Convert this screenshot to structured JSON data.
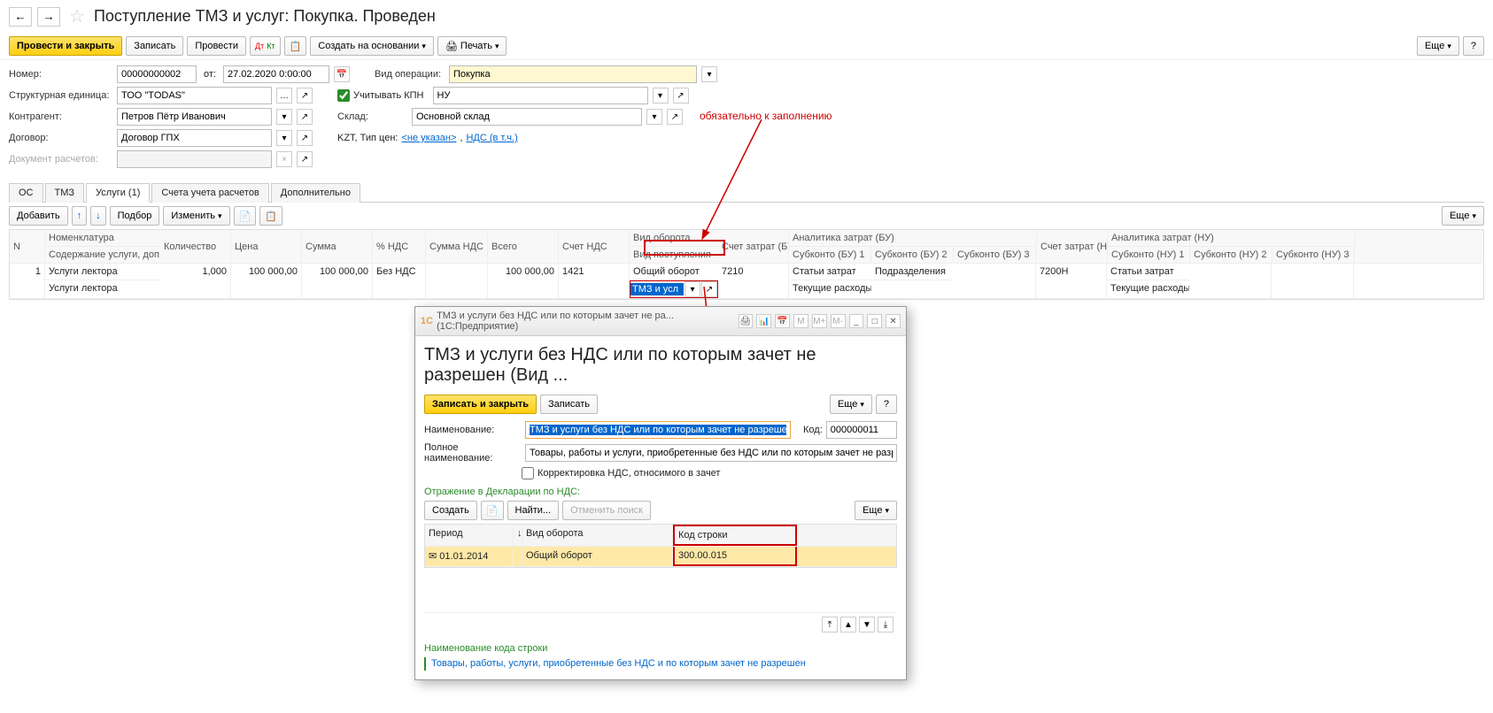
{
  "header": {
    "title": "Поступление ТМЗ и услуг: Покупка. Проведен"
  },
  "toolbar": {
    "post_close": "Провести и закрыть",
    "write": "Записать",
    "post": "Провести",
    "create_based": "Создать на основании",
    "print": "Печать",
    "more": "Еще",
    "help": "?"
  },
  "form": {
    "number_label": "Номер:",
    "number_value": "00000000002",
    "from_label": "от:",
    "date_value": "27.02.2020 0:00:00",
    "operation_label": "Вид операции:",
    "operation_value": "Покупка",
    "unit_label": "Структурная единица:",
    "unit_value": "ТОО \"TODAS\"",
    "kpn_label": "Учитывать КПН",
    "kpn_value": "НУ",
    "counterparty_label": "Контрагент:",
    "counterparty_value": "Петров Пётр Иванович",
    "warehouse_label": "Склад:",
    "warehouse_value": "Основной склад",
    "contract_label": "Договор:",
    "contract_value": "Договор ГПХ",
    "settlement_doc_label": "Документ расчетов:",
    "price_info_prefix": "KZT, Тип цен: ",
    "price_info_link1": "<не указан>",
    "price_info_sep": ", ",
    "price_info_link2": "НДС (в т.ч.)"
  },
  "tabs": {
    "os": "ОС",
    "tmz": "ТМЗ",
    "services": "Услуги (1)",
    "accounts": "Счета учета расчетов",
    "additional": "Дополнительно"
  },
  "subtoolbar": {
    "add": "Добавить",
    "select": "Подбор",
    "change": "Изменить",
    "more": "Еще"
  },
  "grid": {
    "headers": {
      "n": "N",
      "nomenclature": "Номенклатура",
      "content": "Содержание услуги, доп.",
      "qty": "Количество",
      "price": "Цена",
      "sum": "Сумма",
      "nds_percent": "% НДС",
      "nds_sum": "Сумма НДС",
      "total": "Всего",
      "nds_account": "Счет НДС",
      "turnover_type": "Вид оборота",
      "receipt_type": "Вид поступления",
      "cost_account_bu": "Счет затрат (БУ)",
      "analytics_bu": "Аналитика затрат (БУ)",
      "subconto_bu1": "Субконто (БУ) 1",
      "subconto_bu2": "Субконто (БУ) 2",
      "subconto_bu3": "Субконто (БУ) 3",
      "cost_account_nu": "Счет затрат (НУ)",
      "analytics_nu": "Аналитика затрат (НУ)",
      "subconto_nu1": "Субконто (НУ) 1",
      "subconto_nu2": "Субконто (НУ) 2",
      "subconto_nu3": "Субконто (НУ) 3"
    },
    "row": {
      "n": "1",
      "nomenclature": "Услуги лектора",
      "content": "Услуги лектора",
      "qty": "1,000",
      "price": "100 000,00",
      "sum": "100 000,00",
      "nds_percent": "Без НДС",
      "nds_sum": "",
      "total": "100 000,00",
      "nds_account": "1421",
      "turnover_type": "Общий оборот",
      "receipt_type": "ТМЗ и усл",
      "cost_account_bu": "7210",
      "subconto_bu1_r1": "Статьи затрат",
      "subconto_bu1_r2": "Текущие расходы",
      "subconto_bu2_r1": "Подразделения",
      "cost_account_nu": "7200Н",
      "subconto_nu1_r1": "Статьи затрат",
      "subconto_nu1_r2": "Текущие расходы"
    }
  },
  "annotation": {
    "mandatory": "обязательно к заполнению"
  },
  "modal": {
    "titlebar": "ТМЗ и услуги без НДС или по которым зачет не ра... (1С:Предприятие)",
    "big_title": "ТМЗ и услуги без НДС или по которым зачет не разрешен (Вид ...",
    "save_close": "Записать и закрыть",
    "write": "Записать",
    "more": "Еще",
    "help": "?",
    "name_label": "Наименование:",
    "name_value": "ТМЗ и услуги без НДС или по которым зачет не разрешен",
    "code_label": "Код:",
    "code_value": "000000011",
    "full_name_label": "Полное наименование:",
    "full_name_value": "Товары, работы и услуги, приобретенные без НДС или по которым зачет не разрешен",
    "nds_corr": "Корректировка НДС, относимого в зачет",
    "section": "Отражение в Декларации по НДС:",
    "create": "Создать",
    "find": "Найти...",
    "cancel_find": "Отменить поиск",
    "tbl_period": "Период",
    "tbl_turnover": "Вид оборота",
    "tbl_code": "Код строки",
    "row_period": "01.01.2014",
    "row_turnover": "Общий оборот",
    "row_code": "300.00.015",
    "code_section": "Наименование кода строки",
    "code_desc": "Товары, работы, услуги, приобретенные без НДС и по которым зачет не разрешен"
  }
}
